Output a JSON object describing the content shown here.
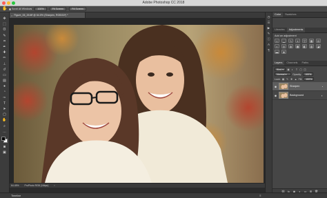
{
  "window": {
    "title": "Adobe Photoshop CC 2018",
    "traffic_lights": [
      "#ff5f57",
      "#febc2e",
      "#28c840"
    ]
  },
  "options_bar": {
    "tool_icon": "hand-icon",
    "scroll_all_label": "Scroll All Windows",
    "buttons": [
      "100%",
      "Fit Screen",
      "Fill Screen"
    ]
  },
  "document": {
    "tab_label": "Figure_06_26.tiff @ 64.5% (Sharpen, RGB/16*) *",
    "zoom_status": "64.45%",
    "profile_status": "ProPhoto RGB (16bpc)"
  },
  "toolbar": {
    "tools": [
      "move-icon",
      "marquee-icon",
      "lasso-icon",
      "quick-select-icon",
      "crop-icon",
      "eyedropper-icon",
      "healing-icon",
      "brush-icon",
      "clone-stamp-icon",
      "history-brush-icon",
      "eraser-icon",
      "gradient-icon",
      "blur-icon",
      "dodge-icon",
      "pen-icon",
      "type-icon",
      "path-select-icon",
      "rectangle-icon",
      "hand-icon",
      "zoom-icon",
      "more-icon"
    ],
    "foreground": "#000000",
    "background": "#ffffff"
  },
  "panels": {
    "top_tabs": [
      "Color",
      "Swatches"
    ],
    "mid_tabs": [
      "Libraries",
      "Adjustments"
    ],
    "adjustments_title": "Add an adjustment",
    "layers_tabs": [
      "Layers",
      "Channels",
      "Paths"
    ],
    "blend_mode": "Normal",
    "opacity_label": "Opacity:",
    "opacity_value": "100%",
    "lock_label": "Lock:",
    "fill_label": "Fill:",
    "fill_value": "100%",
    "kind_label": "Kind",
    "layers": [
      {
        "name": "Sharpen",
        "active": true
      },
      {
        "name": "Background",
        "active": false
      }
    ]
  },
  "timeline": {
    "label": "Timeline"
  },
  "colors": {
    "accent": "#464646"
  }
}
